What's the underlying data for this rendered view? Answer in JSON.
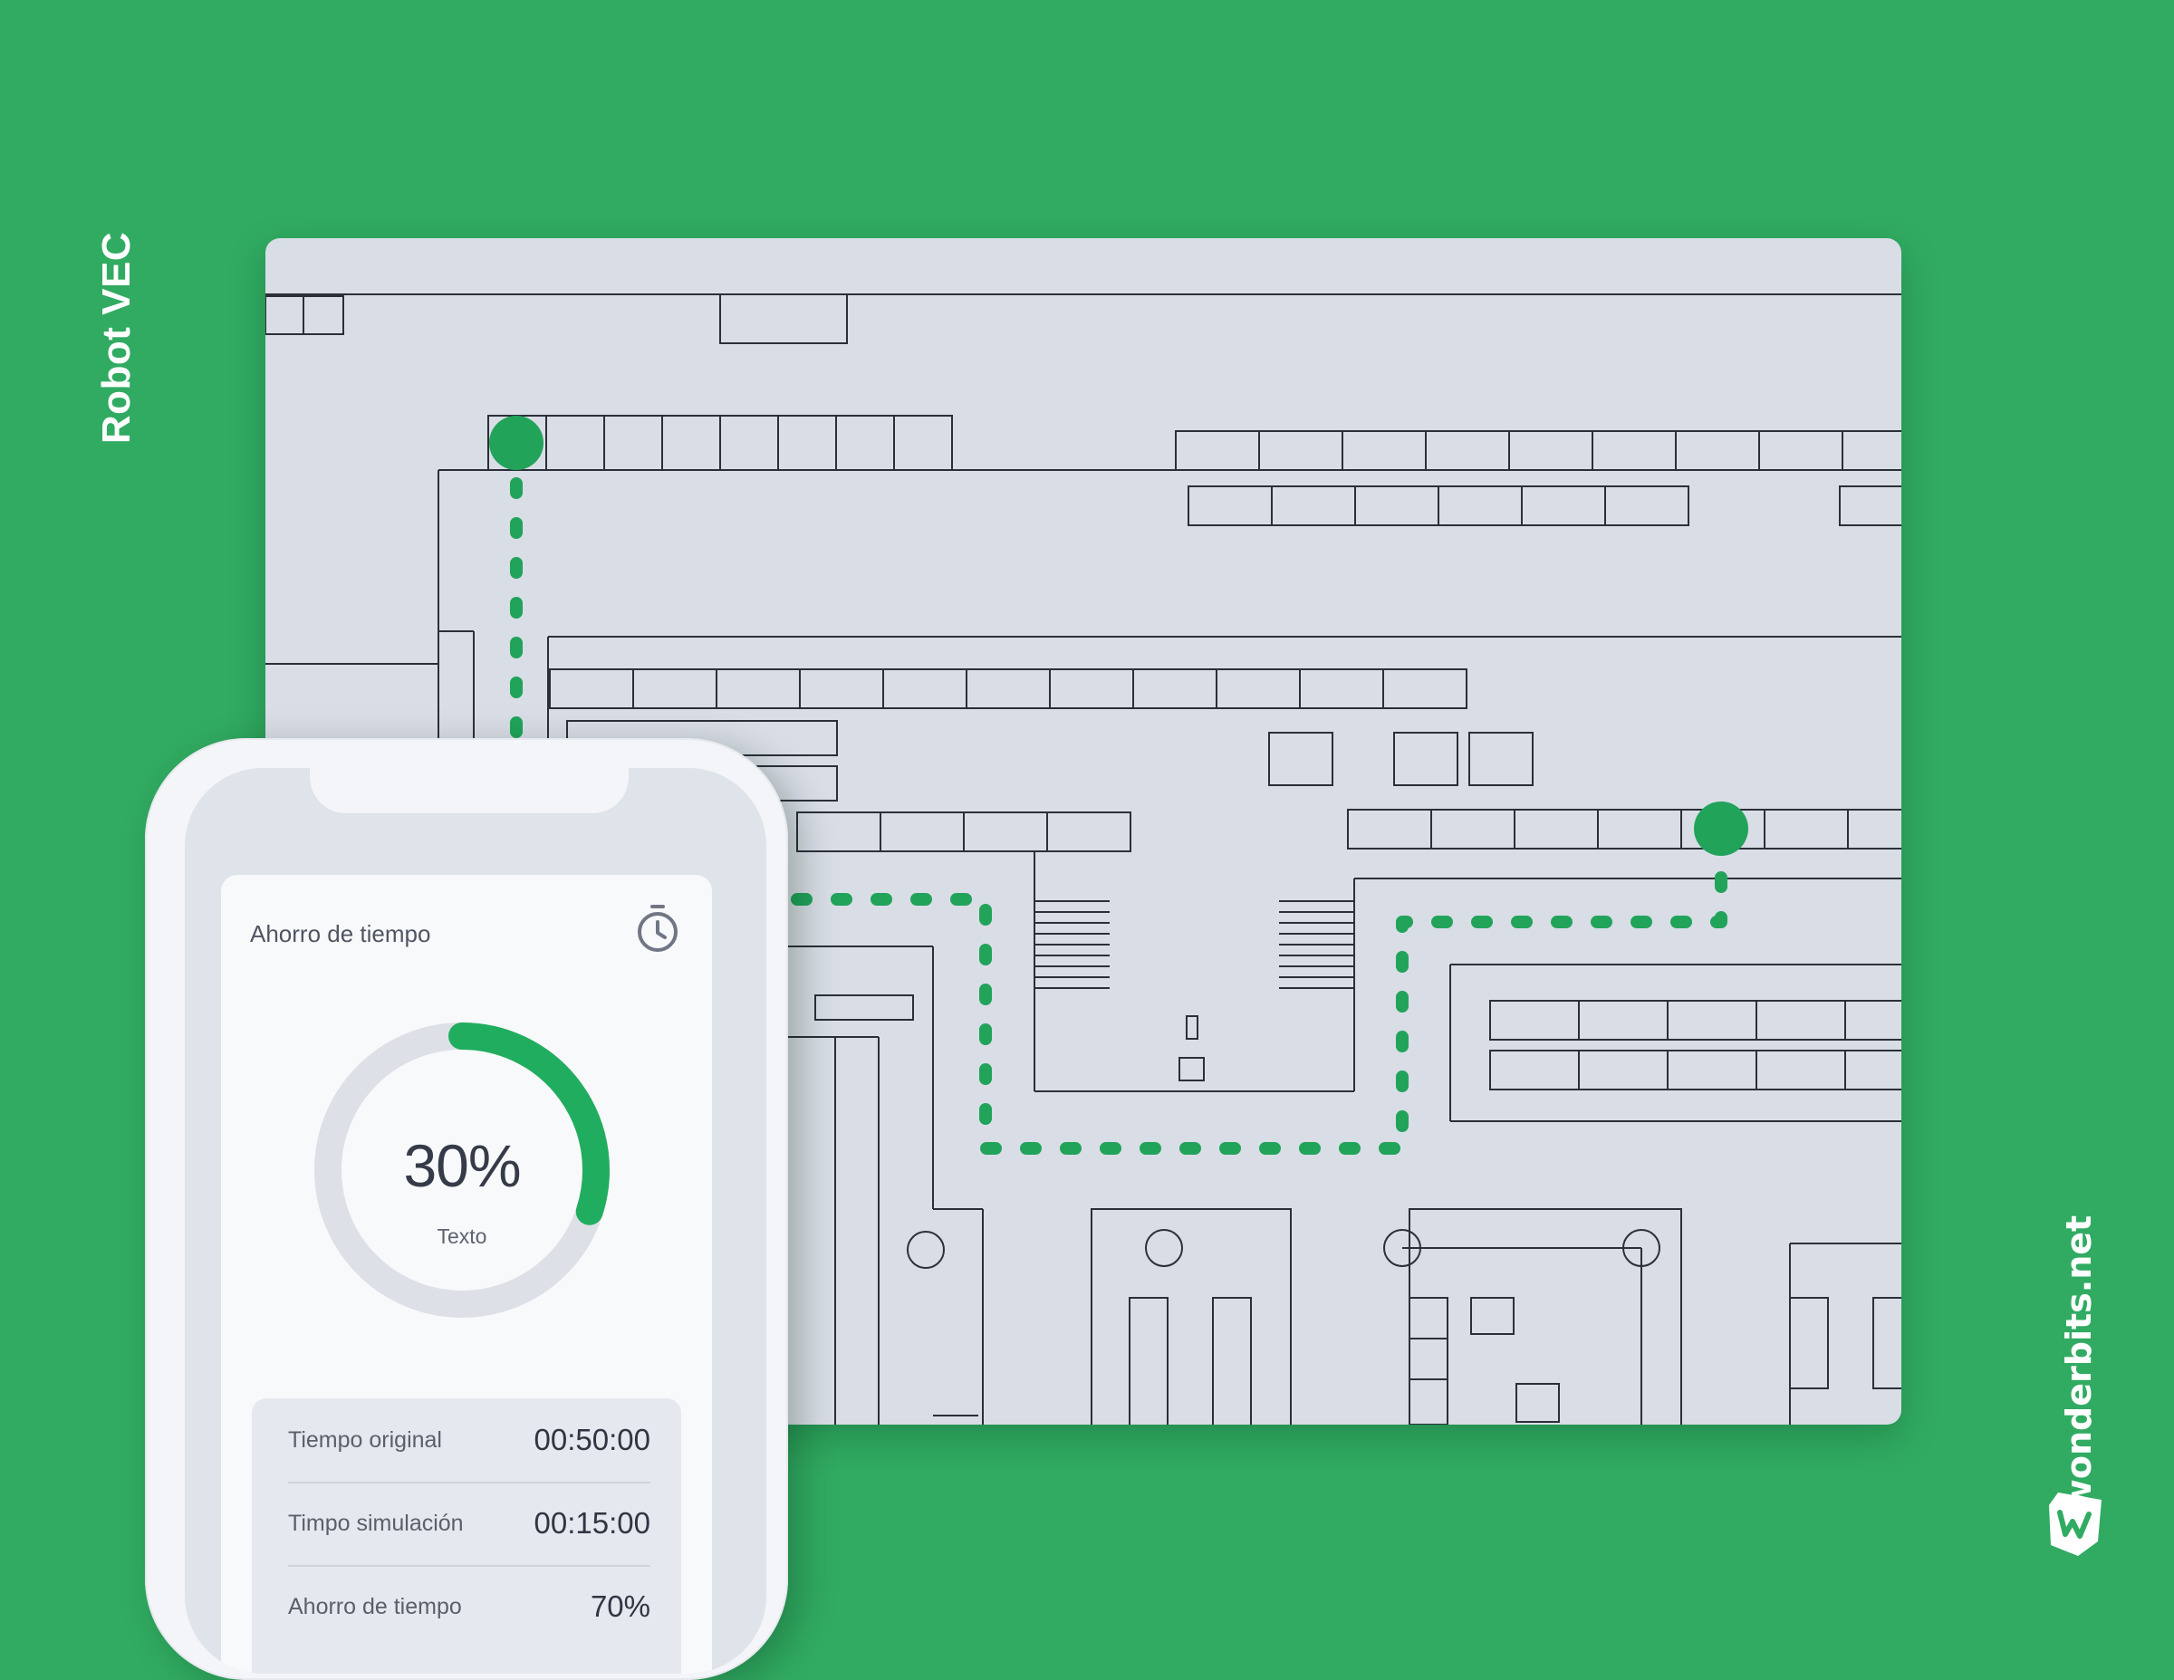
{
  "side_title": "Robot VEC",
  "brand": {
    "url": "wonderbits.net",
    "logo_icon": "wonderbits-w-logo-icon"
  },
  "colors": {
    "background": "#31ab62",
    "route": "#21a35a",
    "map_bg": "#d9dde6",
    "map_lines": "#2b2f38",
    "gauge_track": "#dde0e7",
    "gauge_fill": "#21ad5f"
  },
  "map": {
    "route_style": "dashed",
    "markers": [
      "start-marker",
      "end-marker"
    ]
  },
  "phone": {
    "card": {
      "title": "Ahorro de tiempo",
      "icon": "stopwatch-icon",
      "gauge": {
        "value_text": "30%",
        "fraction": 0.3,
        "caption": "Texto"
      },
      "stats": [
        {
          "label": "Tiempo original",
          "value": "00:50:00"
        },
        {
          "label": "Timpo simulación",
          "value": "00:15:00"
        },
        {
          "label": "Ahorro de tiempo",
          "value": "70%"
        }
      ]
    }
  }
}
